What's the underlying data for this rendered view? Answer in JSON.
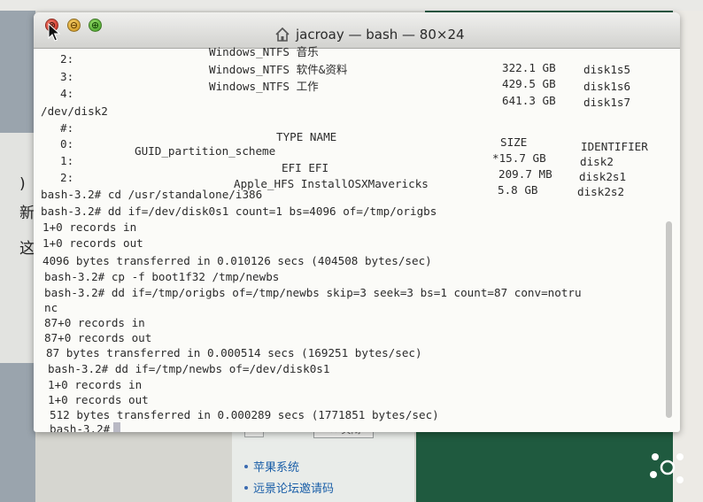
{
  "window": {
    "title": "jacroay — bash — 80×24",
    "home_icon": "home-icon",
    "buttons": [
      "close",
      "minimize",
      "zoom"
    ],
    "close_glyph": "⊗",
    "min_glyph": "⊖",
    "zoom_glyph": "⊕"
  },
  "terminal": {
    "disk1_rows": [
      {
        "num": "2:",
        "type": "Windows_NTFS 音乐",
        "size": "",
        "id": ""
      },
      {
        "num": "3:",
        "type": "Windows_NTFS 软件&资料",
        "size": "322.1 GB",
        "id": "disk1s5"
      },
      {
        "num": "4:",
        "type": "Windows_NTFS 工作",
        "size": "429.5 GB",
        "id": "disk1s6"
      },
      {
        "num": "",
        "type": "",
        "size": "641.3 GB",
        "id": "disk1s7"
      }
    ],
    "disk2_header": "/dev/disk2",
    "table_header": {
      "num": "#:",
      "type": "TYPE NAME",
      "size": "SIZE",
      "id": "IDENTIFIER"
    },
    "disk2_rows": [
      {
        "num": "0:",
        "type": "GUID_partition_scheme",
        "size": "*15.7 GB",
        "id": "disk2"
      },
      {
        "num": "1:",
        "type": "EFI EFI",
        "size": "209.7 MB",
        "id": "disk2s1"
      },
      {
        "num": "2:",
        "type": "Apple_HFS InstallOSXMavericks",
        "size": "5.8 GB",
        "id": "disk2s2"
      }
    ],
    "lines": [
      "bash-3.2# cd /usr/standalone/i386",
      "bash-3.2# dd if=/dev/disk0s1 count=1 bs=4096 of=/tmp/origbs",
      "1+0 records in",
      "1+0 records out",
      "4096 bytes transferred in 0.010126 secs (404508 bytes/sec)",
      "bash-3.2# cp -f boot1f32 /tmp/newbs",
      "bash-3.2# dd if=/tmp/origbs of=/tmp/newbs skip=3 seek=3 bs=1 count=87 conv=notru",
      "nc",
      "87+0 records in",
      "87+0 records out",
      "87 bytes transferred in 0.000514 secs (169251 bytes/sec)",
      "bash-3.2# dd if=/tmp/newbs of=/dev/disk0s1",
      "1+0 records in",
      "1+0 records out",
      "512 bytes transferred in 0.000289 secs (1771851 bytes/sec)"
    ],
    "prompt": "bash-3.2#"
  },
  "background": {
    "left_chars": [
      ")",
      "新",
      "这"
    ],
    "close_button": "✕ 关闭",
    "links": [
      "苹果系统",
      "远景论坛邀请码"
    ],
    "colors": {
      "link": "#1b5fa8",
      "desktop_green": "#1f5a3f"
    }
  }
}
